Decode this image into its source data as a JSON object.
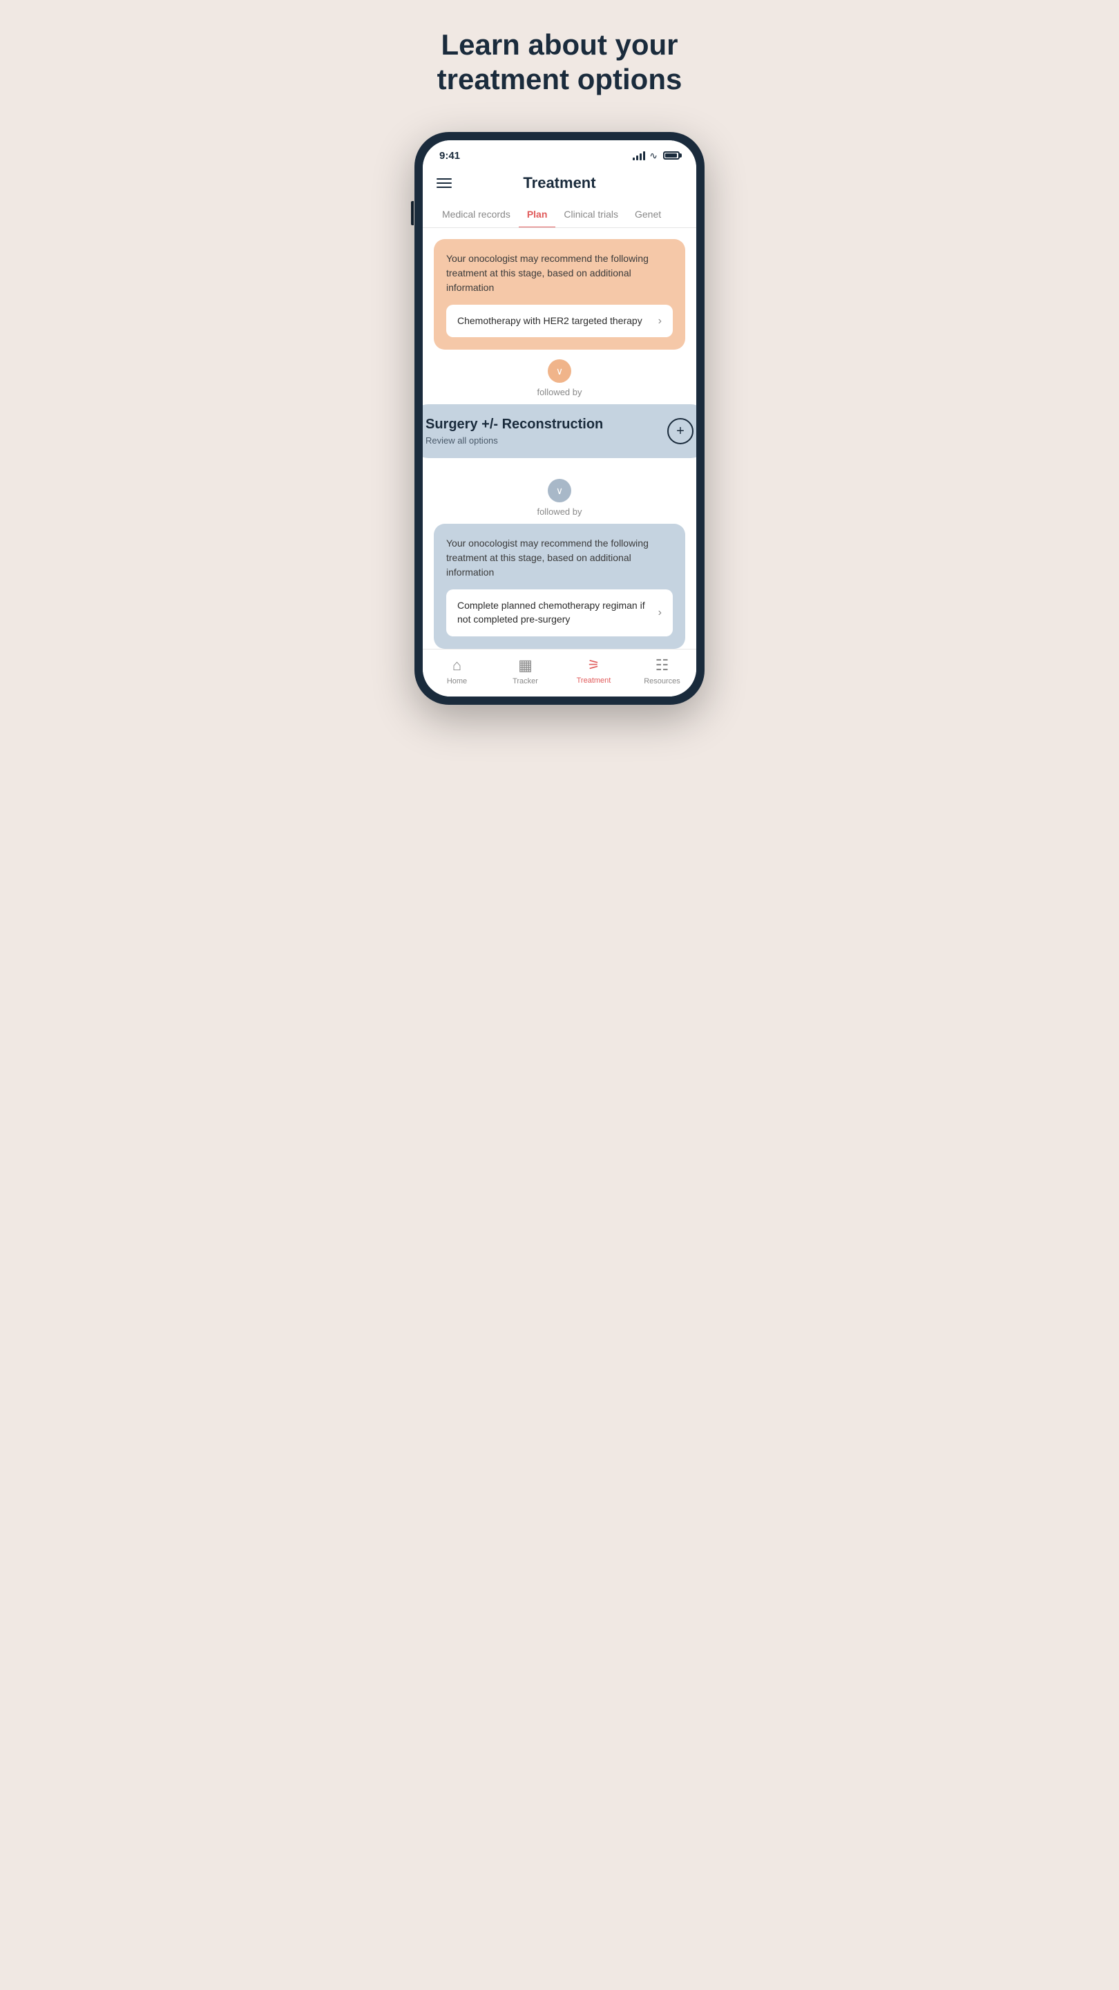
{
  "headline": {
    "line1": "Learn about your",
    "line2": "treatment options"
  },
  "phone": {
    "status_bar": {
      "time": "9:41",
      "signal_label": "signal",
      "wifi_label": "wifi",
      "battery_label": "battery"
    },
    "header": {
      "menu_icon": "hamburger-menu",
      "title": "Treatment"
    },
    "tabs": [
      {
        "label": "Medical records",
        "active": false
      },
      {
        "label": "Plan",
        "active": true
      },
      {
        "label": "Clinical trials",
        "active": false
      },
      {
        "label": "Genet",
        "active": false
      }
    ],
    "first_card": {
      "description": "Your onocologist may recommend the following treatment at this stage, based on additional information",
      "option_text": "Chemotherapy with HER2 targeted therapy",
      "chevron": "›"
    },
    "first_connector": {
      "chevron": "∨",
      "label": "followed by"
    },
    "surgery_card": {
      "title": "Surgery +/- Reconstruction",
      "subtitle": "Review all options",
      "add_icon": "+"
    },
    "second_connector": {
      "chevron": "∨",
      "label": "followed by"
    },
    "second_card": {
      "description": "Your onocologist may recommend the following treatment at this stage, based on additional information",
      "option_text": "Complete planned chemotherapy regiman if not completed pre-surgery",
      "chevron": "›"
    },
    "bottom_nav": [
      {
        "label": "Home",
        "icon": "🏠",
        "active": false
      },
      {
        "label": "Tracker",
        "icon": "📅",
        "active": false
      },
      {
        "label": "Treatment",
        "icon": "treatment",
        "active": true
      },
      {
        "label": "Resources",
        "icon": "📋",
        "active": false
      }
    ]
  }
}
